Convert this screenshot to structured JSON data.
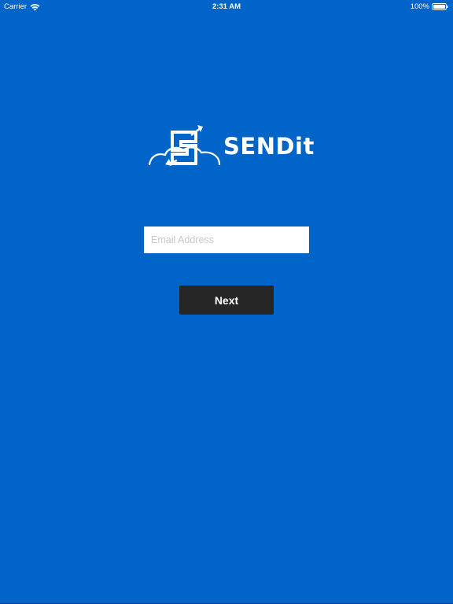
{
  "status_bar": {
    "carrier": "Carrier",
    "time": "2:31 AM",
    "battery_percent": "100%",
    "battery_level": 1.0,
    "wifi_icon": "wifi-icon",
    "battery_icon": "battery-icon"
  },
  "logo": {
    "text": "SENDit",
    "icon": "sendit-cloud-logo-icon"
  },
  "email_field": {
    "value": "",
    "placeholder": "Email Address"
  },
  "next_button": {
    "label": "Next"
  },
  "colors": {
    "background": "#0064c8",
    "button": "#262626",
    "input_background": "#ffffff",
    "placeholder": "#c7c7cd",
    "text_light": "#ffffff"
  }
}
